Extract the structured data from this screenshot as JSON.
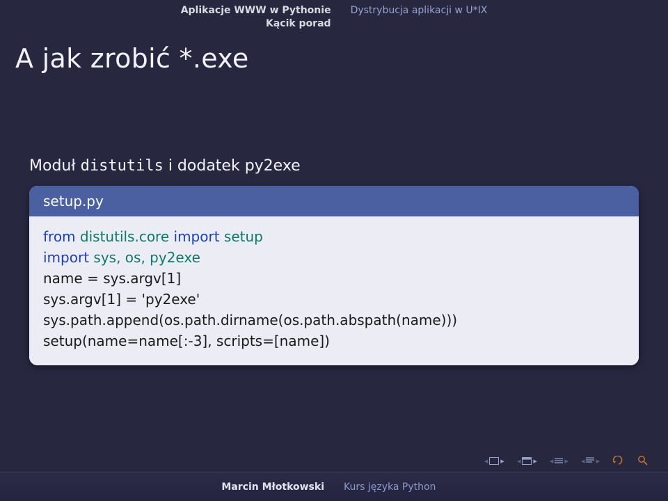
{
  "nav": {
    "left1": "Aplikacje WWW w Pythonie",
    "left2": "Kącik porad",
    "right": "Dystrybucja aplikacji w U*IX"
  },
  "title": "A jak zrobić *.exe",
  "intro": {
    "pre": "Moduł ",
    "mono": "distutils",
    "post": " i dodatek py2exe"
  },
  "block": {
    "title": "setup.py",
    "l1a": "from ",
    "l1b": "distutils.core ",
    "l1c": "import ",
    "l1d": "setup",
    "l2a": "import ",
    "l2b": "sys, os, py2exe",
    "l3": "name = sys.argv[1]",
    "l4": "sys.argv[1] = 'py2exe'",
    "l5": "sys.path.append(os.path.dirname(os.path.abspath(name)))",
    "l6": "setup(name=name[:-3], scripts=[name])"
  },
  "footer": {
    "author": "Marcin Młotkowski",
    "course": "Kurs języka Python"
  }
}
